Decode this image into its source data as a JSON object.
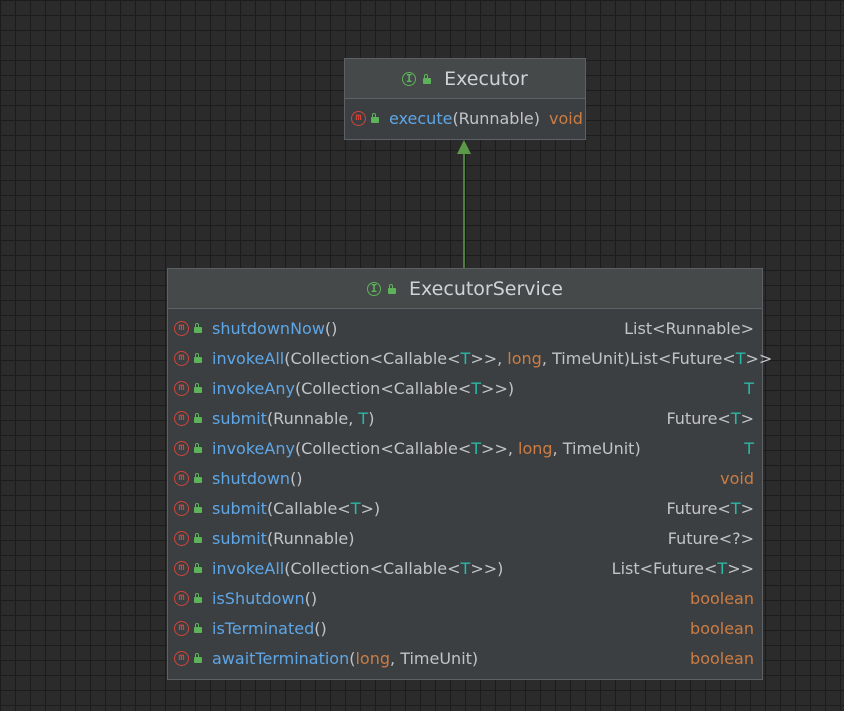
{
  "executor": {
    "title": "Executor",
    "members": [
      {
        "sig": [
          {
            "t": "execute",
            "c": "mname"
          },
          {
            "t": "(Runnable)",
            "c": "plain"
          }
        ],
        "ret": [
          {
            "t": "void",
            "c": "prim"
          }
        ]
      }
    ]
  },
  "executor_service": {
    "title": "ExecutorService",
    "members": [
      {
        "sig": [
          {
            "t": "shutdownNow",
            "c": "mname"
          },
          {
            "t": "()",
            "c": "plain"
          }
        ],
        "ret": [
          {
            "t": "List<Runnable>",
            "c": "plain"
          }
        ]
      },
      {
        "sig": [
          {
            "t": "invokeAll",
            "c": "mname"
          },
          {
            "t": "(Collection<Callable<",
            "c": "plain"
          },
          {
            "t": "T",
            "c": "tparam"
          },
          {
            "t": ">>, ",
            "c": "plain"
          },
          {
            "t": "long",
            "c": "prim"
          },
          {
            "t": ", TimeUnit)",
            "c": "plain"
          }
        ],
        "ret": [
          {
            "t": "List<Future<",
            "c": "plain"
          },
          {
            "t": "T",
            "c": "tparam"
          },
          {
            "t": ">>",
            "c": "plain"
          }
        ]
      },
      {
        "sig": [
          {
            "t": "invokeAny",
            "c": "mname"
          },
          {
            "t": "(Collection<Callable<",
            "c": "plain"
          },
          {
            "t": "T",
            "c": "tparam"
          },
          {
            "t": ">>)",
            "c": "plain"
          }
        ],
        "ret": [
          {
            "t": "T",
            "c": "tparam"
          }
        ]
      },
      {
        "sig": [
          {
            "t": "submit",
            "c": "mname"
          },
          {
            "t": "(Runnable, ",
            "c": "plain"
          },
          {
            "t": "T",
            "c": "tparam"
          },
          {
            "t": ")",
            "c": "plain"
          }
        ],
        "ret": [
          {
            "t": "Future<",
            "c": "plain"
          },
          {
            "t": "T",
            "c": "tparam"
          },
          {
            "t": ">",
            "c": "plain"
          }
        ]
      },
      {
        "sig": [
          {
            "t": "invokeAny",
            "c": "mname"
          },
          {
            "t": "(Collection<Callable<",
            "c": "plain"
          },
          {
            "t": "T",
            "c": "tparam"
          },
          {
            "t": ">>, ",
            "c": "plain"
          },
          {
            "t": "long",
            "c": "prim"
          },
          {
            "t": ", TimeUnit)",
            "c": "plain"
          }
        ],
        "ret": [
          {
            "t": "T",
            "c": "tparam"
          }
        ]
      },
      {
        "sig": [
          {
            "t": "shutdown",
            "c": "mname"
          },
          {
            "t": "()",
            "c": "plain"
          }
        ],
        "ret": [
          {
            "t": "void",
            "c": "prim"
          }
        ]
      },
      {
        "sig": [
          {
            "t": "submit",
            "c": "mname"
          },
          {
            "t": "(Callable<",
            "c": "plain"
          },
          {
            "t": "T",
            "c": "tparam"
          },
          {
            "t": ">)",
            "c": "plain"
          }
        ],
        "ret": [
          {
            "t": "Future<",
            "c": "plain"
          },
          {
            "t": "T",
            "c": "tparam"
          },
          {
            "t": ">",
            "c": "plain"
          }
        ]
      },
      {
        "sig": [
          {
            "t": "submit",
            "c": "mname"
          },
          {
            "t": "(Runnable)",
            "c": "plain"
          }
        ],
        "ret": [
          {
            "t": "Future<?>",
            "c": "plain"
          }
        ]
      },
      {
        "sig": [
          {
            "t": "invokeAll",
            "c": "mname"
          },
          {
            "t": "(Collection<Callable<",
            "c": "plain"
          },
          {
            "t": "T",
            "c": "tparam"
          },
          {
            "t": ">>)",
            "c": "plain"
          }
        ],
        "ret": [
          {
            "t": "List<Future<",
            "c": "plain"
          },
          {
            "t": "T",
            "c": "tparam"
          },
          {
            "t": ">>",
            "c": "plain"
          }
        ]
      },
      {
        "sig": [
          {
            "t": "isShutdown",
            "c": "mname"
          },
          {
            "t": "()",
            "c": "plain"
          }
        ],
        "ret": [
          {
            "t": "boolean",
            "c": "prim"
          }
        ]
      },
      {
        "sig": [
          {
            "t": "isTerminated",
            "c": "mname"
          },
          {
            "t": "()",
            "c": "plain"
          }
        ],
        "ret": [
          {
            "t": "boolean",
            "c": "prim"
          }
        ]
      },
      {
        "sig": [
          {
            "t": "awaitTermination",
            "c": "mname"
          },
          {
            "t": "(",
            "c": "plain"
          },
          {
            "t": "long",
            "c": "prim"
          },
          {
            "t": ", TimeUnit)",
            "c": "plain"
          }
        ],
        "ret": [
          {
            "t": "boolean",
            "c": "prim"
          }
        ]
      }
    ]
  },
  "relations": [
    {
      "from": "ExecutorService",
      "to": "Executor",
      "type": "extends"
    }
  ],
  "colors": {
    "method": "#5ea6e6",
    "primitive": "#cc7c43",
    "type_param": "#2ab7a6",
    "interface_icon": "#5db35a",
    "method_icon": "#d0453b",
    "arrow": "#5b9a48"
  }
}
